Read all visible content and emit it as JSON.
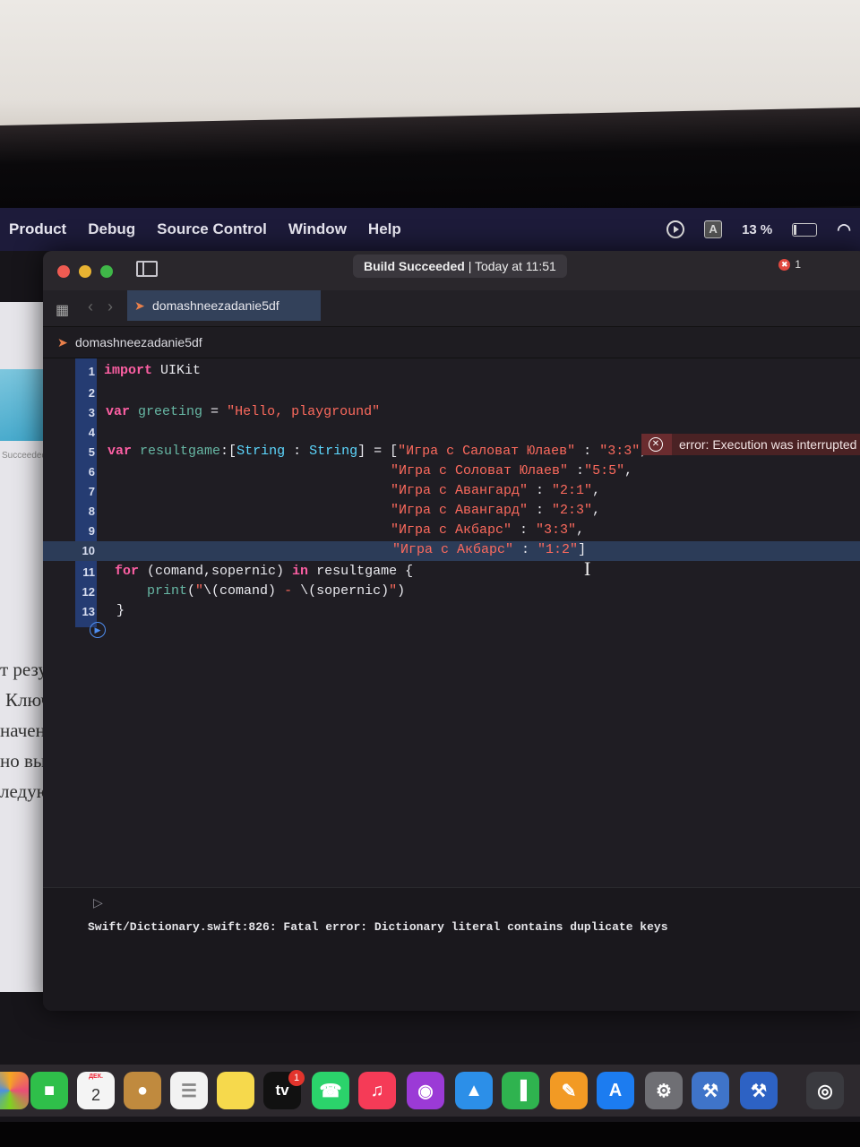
{
  "menubar": {
    "items": [
      "Product",
      "Debug",
      "Source Control",
      "Window",
      "Help"
    ],
    "battery_label": "13 %"
  },
  "background_doc": {
    "succeeded": "Succeeded",
    "lines": [
      "т резул",
      "Ключо",
      "начения",
      "но вывес",
      "ледующ"
    ]
  },
  "window": {
    "build_status_bold": "Build Succeeded",
    "build_status_rest": " | Today at 11:51",
    "error_count": "1",
    "tab_label": "domashneezadanie5df",
    "breadcrumb": "domashneezadanie5df"
  },
  "editor": {
    "line_numbers": [
      "1",
      "2",
      "3",
      "4",
      "5",
      "6",
      "7",
      "8",
      "9",
      "10",
      "11",
      "12",
      "13"
    ],
    "inline_error": "error: Execution was interrupted"
  },
  "console": {
    "output": "Swift/Dictionary.swift:826: Fatal error: Dictionary literal contains duplicate keys"
  },
  "dock": {
    "calendar_month": "ДЕК.",
    "calendar_day": "2",
    "tv_label": "tv",
    "tv_badge": "1"
  }
}
